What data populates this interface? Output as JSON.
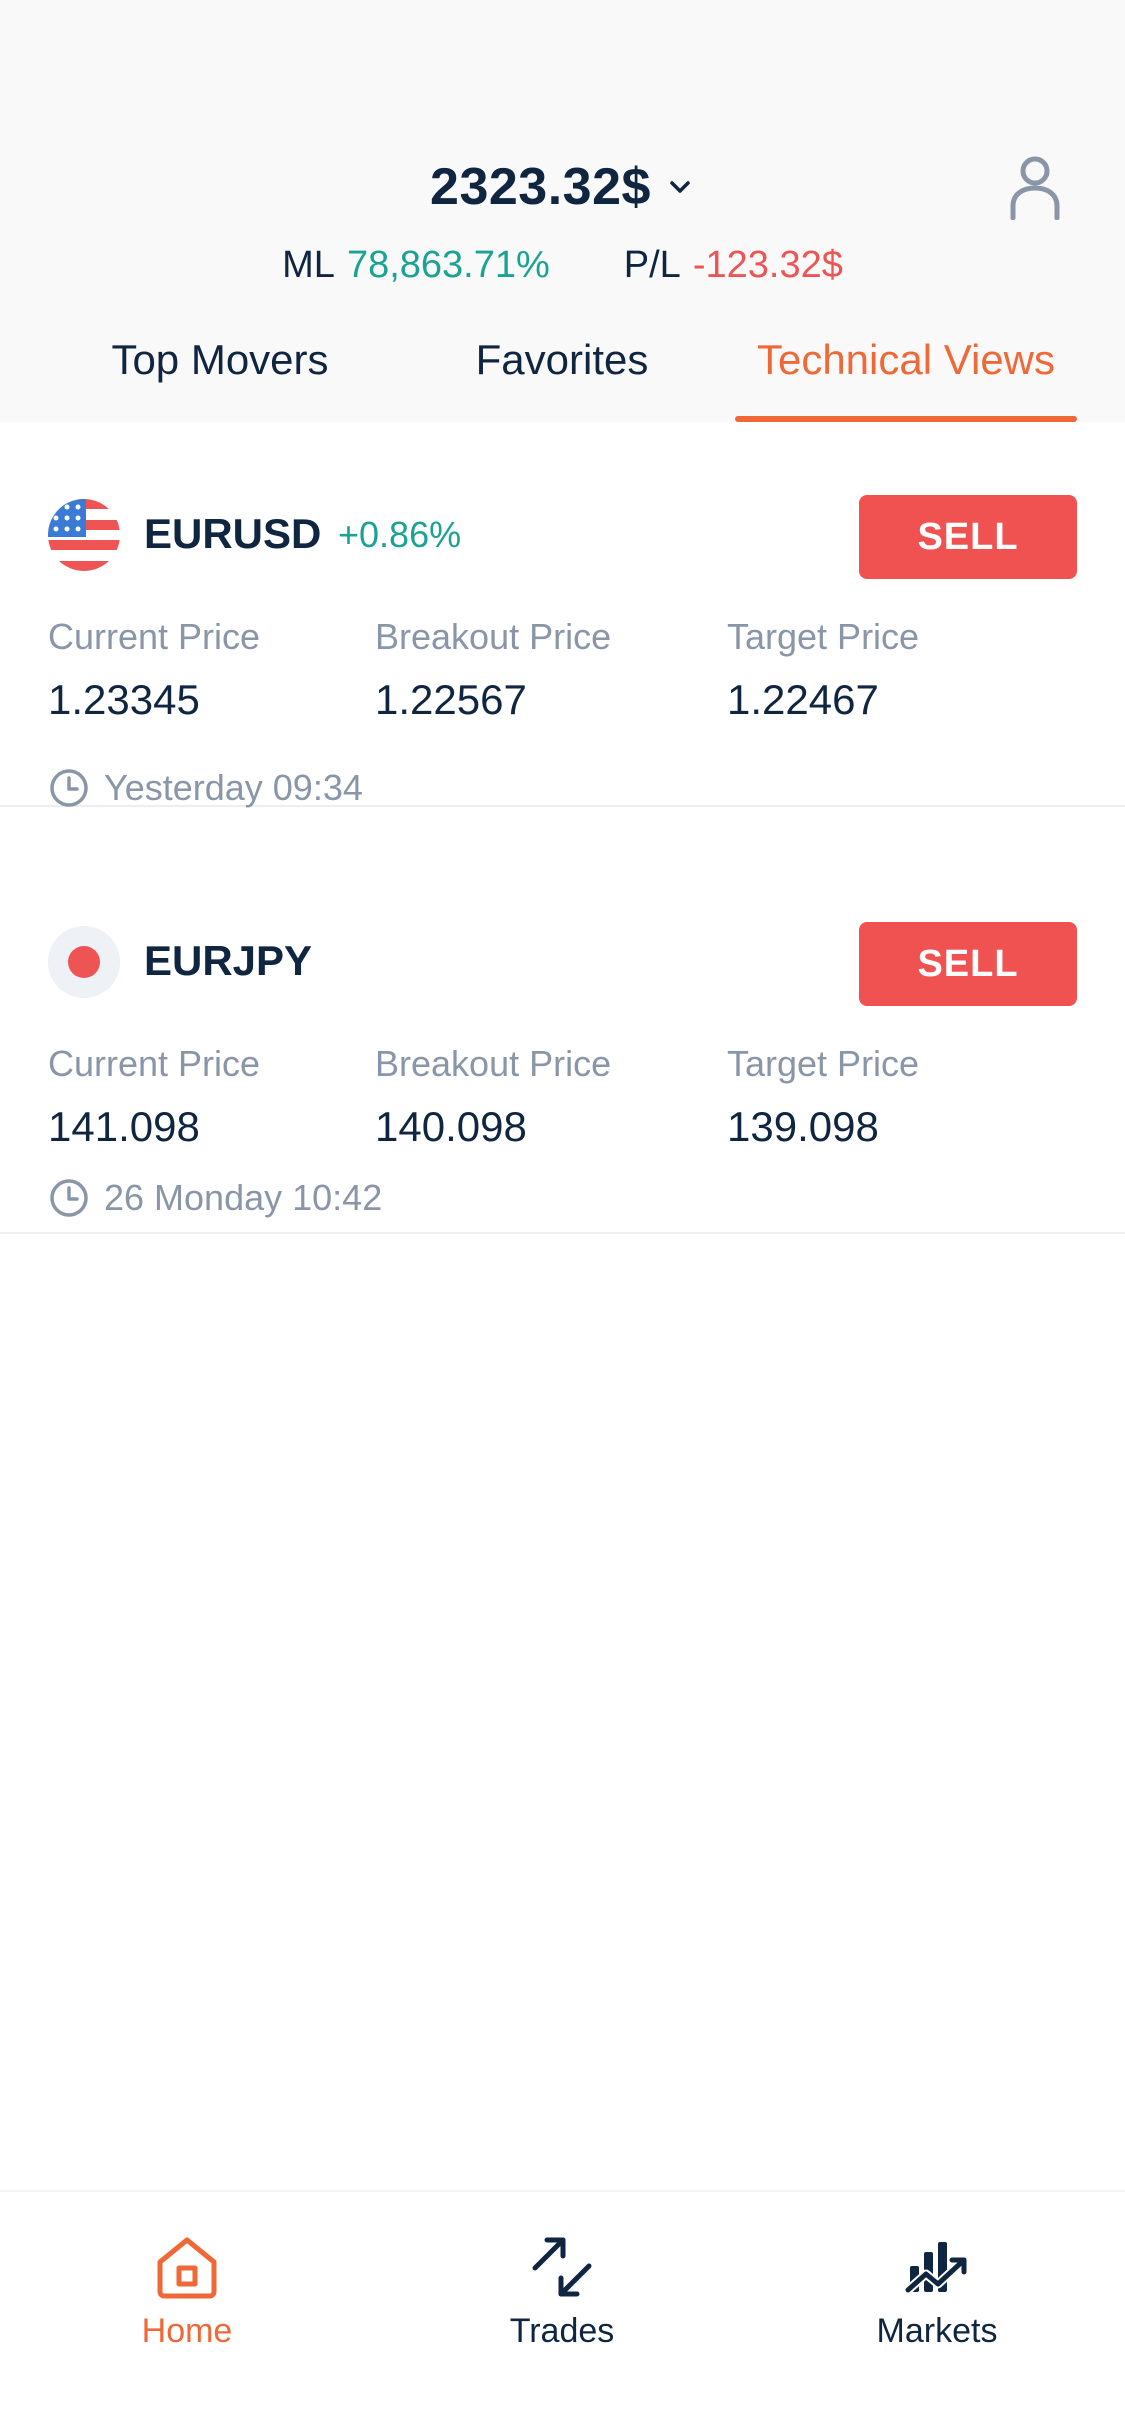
{
  "header": {
    "balance": "2323.32$",
    "ml_label": "ML",
    "ml_value": "78,863.71%",
    "pl_label": "P/L",
    "pl_value": "-123.32$"
  },
  "tabs": [
    {
      "label": "Top Movers",
      "active": false
    },
    {
      "label": "Favorites",
      "active": false
    },
    {
      "label": "Technical Views",
      "active": true
    }
  ],
  "cards": [
    {
      "pair": "EURUSD",
      "change": "+0.86%",
      "flag_icon": "us-flag-icon",
      "action": "SELL",
      "current_label": "Current Price",
      "current_value": "1.23345",
      "breakout_label": "Breakout Price",
      "breakout_value": "1.22567",
      "target_label": "Target Price",
      "target_value": "1.22467",
      "time": "Yesterday 09:34"
    },
    {
      "pair": "EURJPY",
      "change": "",
      "flag_icon": "japan-flag-icon",
      "action": "SELL",
      "current_label": "Current Price",
      "current_value": "141.098",
      "breakout_label": "Breakout Price",
      "breakout_value": "140.098",
      "target_label": "Target Price",
      "target_value": "139.098",
      "time": "26 Monday 10:42"
    }
  ],
  "nav": [
    {
      "label": "Home",
      "icon": "home-icon",
      "active": true
    },
    {
      "label": "Trades",
      "icon": "trades-arrows-icon",
      "active": false
    },
    {
      "label": "Markets",
      "icon": "markets-chart-icon",
      "active": false
    }
  ],
  "colors": {
    "accent": "#ef6837",
    "positive": "#1aa394",
    "negative": "#ee5454",
    "sell": "#f05252",
    "text": "#0f2540",
    "muted": "#8a96a8"
  }
}
